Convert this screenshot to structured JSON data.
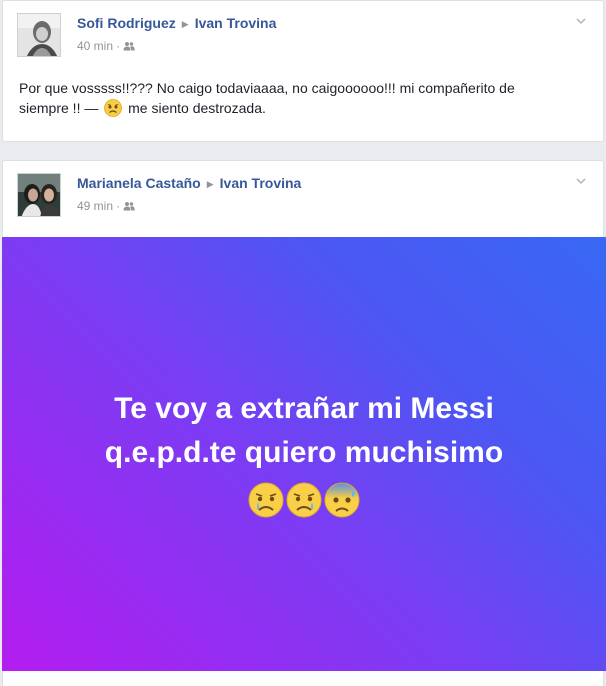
{
  "posts": [
    {
      "author": "Sofi Rodriguez",
      "recipient": "Ivan Trovina",
      "time": "40 min",
      "privacy_icon": "friends-icon",
      "text_before_emoji": "Por que vosssss!!??? No caigo todaviaaaa, no caigoooooo!!! mi compañerito de siempre !! —",
      "emoji": "sad-face-emoji",
      "text_after_emoji": "me siento destrozada."
    },
    {
      "author": "Marianela Castaño",
      "recipient": "Ivan Trovina",
      "time": "49 min",
      "privacy_icon": "friends-icon",
      "banner_line1": "Te voy a extrañar mi Messi",
      "banner_line2": "q.e.p.d.te quiero muchisimo",
      "banner_emojis": [
        "crying-face-emoji",
        "crying-face-emoji",
        "anxious-sweat-face-emoji"
      ],
      "banner_gradient": [
        "#b41cf0",
        "#3868f4"
      ]
    }
  ],
  "colors": {
    "name_link": "#365899",
    "meta_gray": "#90949c",
    "text": "#1d2129",
    "background": "#e9ebee"
  }
}
